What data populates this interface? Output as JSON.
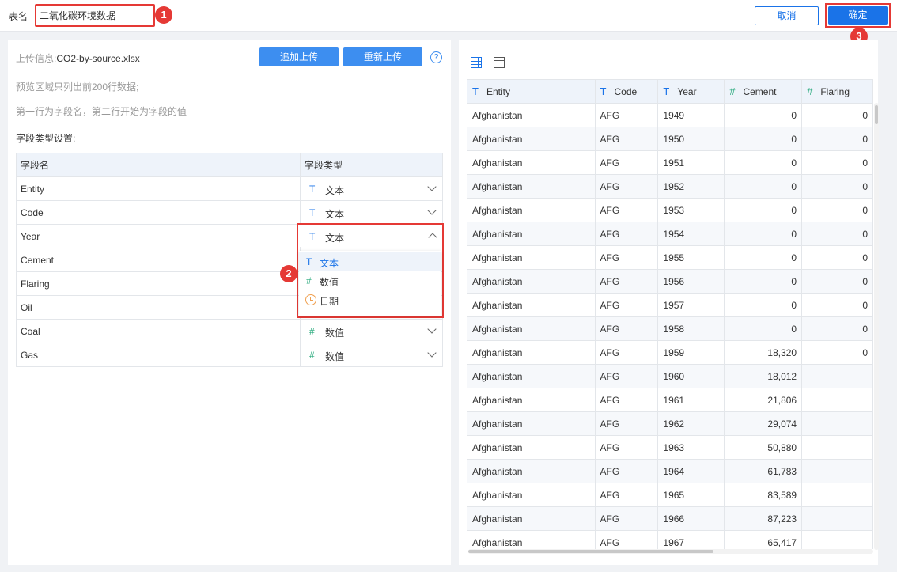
{
  "header": {
    "name_label": "表名",
    "name_value": "二氧化碳环境数据",
    "cancel_label": "取消",
    "confirm_label": "确定",
    "badges": [
      "1",
      "2",
      "3"
    ]
  },
  "upload": {
    "info_label": "上传信息:",
    "file_name": "CO2-by-source.xlsx",
    "append_label": "追加上传",
    "reupload_label": "重新上传",
    "help_icon": "?",
    "hint1": "预览区域只列出前200行数据;",
    "hint2": "第一行为字段名，第二行开始为字段的值"
  },
  "field_settings": {
    "title": "字段类型设置:",
    "col_name": "字段名",
    "col_type": "字段类型",
    "rows": [
      {
        "name": "Entity",
        "type_icon": "T",
        "type": "文本"
      },
      {
        "name": "Code",
        "type_icon": "T",
        "type": "文本"
      },
      {
        "name": "Year",
        "type_icon": "T",
        "type": "文本"
      },
      {
        "name": "Cement",
        "type_icon": "",
        "type": ""
      },
      {
        "name": "Flaring",
        "type_icon": "",
        "type": ""
      },
      {
        "name": "Oil",
        "type_icon": "",
        "type": ""
      },
      {
        "name": "Coal",
        "type_icon": "#",
        "type": "数值"
      },
      {
        "name": "Gas",
        "type_icon": "#",
        "type": "数值"
      }
    ],
    "dropdown": {
      "selected_icon": "T",
      "selected": "文本",
      "options": [
        {
          "icon": "T",
          "label": "文本"
        },
        {
          "icon": "#",
          "label": "数值"
        },
        {
          "icon": "clock",
          "label": "日期"
        }
      ]
    }
  },
  "preview": {
    "columns": [
      {
        "icon": "T",
        "name": "Entity"
      },
      {
        "icon": "T",
        "name": "Code"
      },
      {
        "icon": "T",
        "name": "Year"
      },
      {
        "icon": "#",
        "name": "Cement"
      },
      {
        "icon": "#",
        "name": "Flaring"
      }
    ],
    "rows": [
      [
        "Afghanistan",
        "AFG",
        "1949",
        "0",
        "0"
      ],
      [
        "Afghanistan",
        "AFG",
        "1950",
        "0",
        "0"
      ],
      [
        "Afghanistan",
        "AFG",
        "1951",
        "0",
        "0"
      ],
      [
        "Afghanistan",
        "AFG",
        "1952",
        "0",
        "0"
      ],
      [
        "Afghanistan",
        "AFG",
        "1953",
        "0",
        "0"
      ],
      [
        "Afghanistan",
        "AFG",
        "1954",
        "0",
        "0"
      ],
      [
        "Afghanistan",
        "AFG",
        "1955",
        "0",
        "0"
      ],
      [
        "Afghanistan",
        "AFG",
        "1956",
        "0",
        "0"
      ],
      [
        "Afghanistan",
        "AFG",
        "1957",
        "0",
        "0"
      ],
      [
        "Afghanistan",
        "AFG",
        "1958",
        "0",
        "0"
      ],
      [
        "Afghanistan",
        "AFG",
        "1959",
        "18,320",
        "0"
      ],
      [
        "Afghanistan",
        "AFG",
        "1960",
        "18,012",
        ""
      ],
      [
        "Afghanistan",
        "AFG",
        "1961",
        "21,806",
        ""
      ],
      [
        "Afghanistan",
        "AFG",
        "1962",
        "29,074",
        ""
      ],
      [
        "Afghanistan",
        "AFG",
        "1963",
        "50,880",
        ""
      ],
      [
        "Afghanistan",
        "AFG",
        "1964",
        "61,783",
        ""
      ],
      [
        "Afghanistan",
        "AFG",
        "1965",
        "83,589",
        ""
      ],
      [
        "Afghanistan",
        "AFG",
        "1966",
        "87,223",
        ""
      ],
      [
        "Afghanistan",
        "AFG",
        "1967",
        "65,417",
        ""
      ]
    ]
  }
}
